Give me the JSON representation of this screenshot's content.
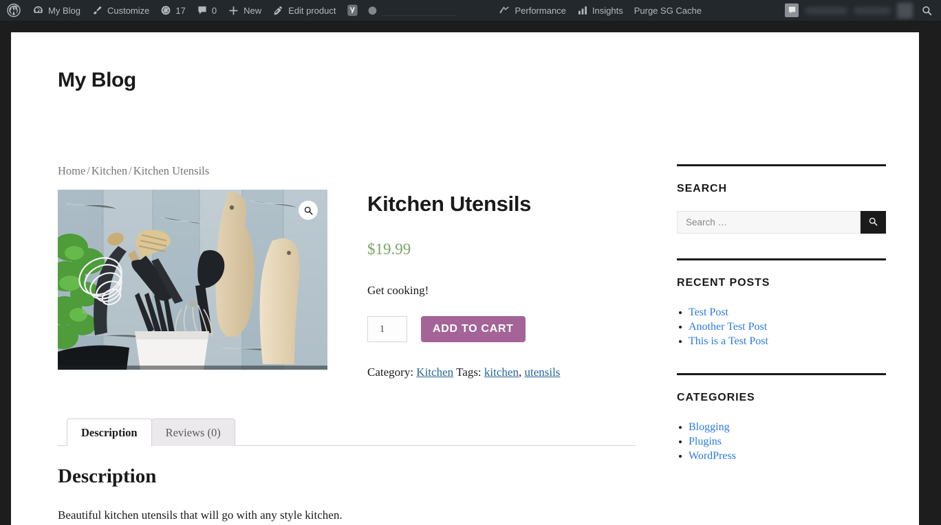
{
  "adminbar": {
    "wp_logo": "wordpress-logo",
    "items": [
      {
        "icon": "dashboard-icon",
        "label": "My Blog"
      },
      {
        "icon": "paintbrush-icon",
        "label": "Customize"
      },
      {
        "icon": "updates-icon",
        "label": "17"
      },
      {
        "icon": "comment-bubble-icon",
        "label": "0"
      },
      {
        "icon": "plus-icon",
        "label": "New"
      },
      {
        "icon": "pencil-icon",
        "label": "Edit product"
      },
      {
        "icon": "yoast-seo-icon",
        "label": ""
      },
      {
        "icon": "seo-score-dot-icon",
        "label": ""
      }
    ],
    "right_items": [
      {
        "icon": "performance-icon",
        "label": "Performance"
      },
      {
        "icon": "insights-bars-icon",
        "label": "Insights"
      },
      {
        "icon": "",
        "label": "Purge SG Cache"
      }
    ],
    "account": {
      "icon": "flag-icon",
      "name_redacted": true
    },
    "search_icon": "search-icon"
  },
  "site": {
    "title": "My Blog"
  },
  "breadcrumb": {
    "items": [
      "Home",
      "Kitchen",
      "Kitchen Utensils"
    ],
    "separator": "/"
  },
  "product": {
    "title": "Kitchen Utensils",
    "price": "$19.99",
    "price_color": "#77a464",
    "short_description": "Get cooking!",
    "quantity": "1",
    "add_to_cart_label": "ADD TO CART",
    "add_to_cart_color": "#a46497",
    "zoom_icon": "magnifier-zoom-icon",
    "image_alt": "Kitchen utensils in a white holder with wooden cutting boards and basil",
    "meta": {
      "category_label": "Category:",
      "categories": [
        "Kitchen"
      ],
      "tags_label": "Tags:",
      "tags": [
        "kitchen",
        "utensils"
      ],
      "tag_separator": ", "
    }
  },
  "tabs": [
    {
      "label": "Description",
      "active": true
    },
    {
      "label": "Reviews (0)",
      "active": false
    }
  ],
  "panel": {
    "heading": "Description",
    "body": "Beautiful kitchen utensils that will go with any style kitchen."
  },
  "sidebar": {
    "search": {
      "heading": "SEARCH",
      "value": "",
      "placeholder": "Search …",
      "button_icon": "search-icon"
    },
    "recent_posts": {
      "heading": "RECENT POSTS",
      "items": [
        "Test Post",
        "Another Test Post",
        "This is a Test Post"
      ]
    },
    "categories": {
      "heading": "CATEGORIES",
      "items": [
        "Blogging",
        "Plugins",
        "WordPress"
      ]
    },
    "link_color": "#2a7ae2"
  }
}
